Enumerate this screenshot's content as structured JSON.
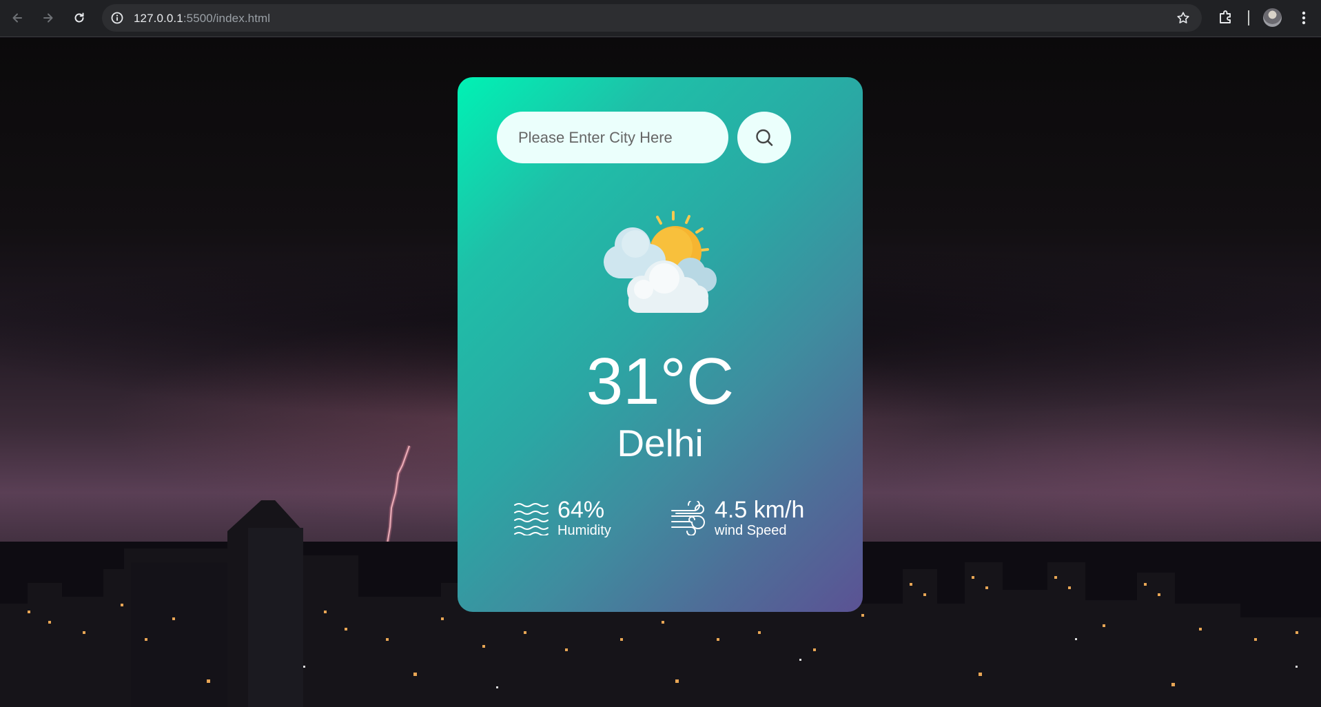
{
  "browser": {
    "url_host": "127.0.0.1",
    "url_path": ":5500/index.html"
  },
  "search": {
    "placeholder": "Please Enter City Here",
    "value": ""
  },
  "weather": {
    "condition_icon": "partly-cloudy-icon",
    "temperature": "31°C",
    "city": "Delhi",
    "humidity_value": "64%",
    "humidity_label": "Humidity",
    "wind_value": "4.5 km/h",
    "wind_label": "wind Speed"
  },
  "colors": {
    "card_gradient_start": "#00f2b4",
    "card_gradient_end": "#5b5294",
    "input_background": "#ebfffc"
  }
}
